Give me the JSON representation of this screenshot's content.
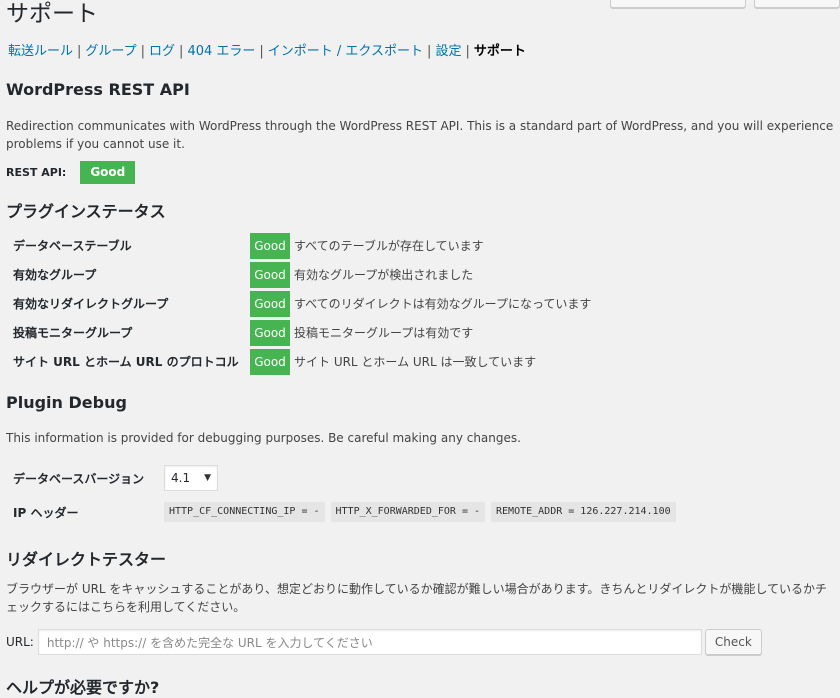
{
  "page": {
    "title": "サポート"
  },
  "nav": {
    "items": [
      "転送ルール",
      "グループ",
      "ログ",
      "404 エラー",
      "インポート / エクスポート",
      "設定"
    ],
    "current": "サポート",
    "separator": "|"
  },
  "rest_api": {
    "heading": "WordPress REST API",
    "description": "Redirection communicates with WordPress through the WordPress REST API. This is a standard part of WordPress, and you will experience problems if you cannot use it.",
    "label": "REST API:",
    "status": "Good"
  },
  "plugin_status": {
    "heading": "プラグインステータス",
    "rows": [
      {
        "label": "データベーステーブル",
        "status": "Good",
        "message": "すべてのテーブルが存在しています"
      },
      {
        "label": "有効なグループ",
        "status": "Good",
        "message": "有効なグループが検出されました"
      },
      {
        "label": "有効なリダイレクトグループ",
        "status": "Good",
        "message": "すべてのリダイレクトは有効なグループになっています"
      },
      {
        "label": "投稿モニターグループ",
        "status": "Good",
        "message": "投稿モニターグループは有効です"
      },
      {
        "label": "サイト URL とホーム URL のプロトコル",
        "status": "Good",
        "message": "サイト URL とホーム URL は一致しています"
      }
    ]
  },
  "debug": {
    "heading": "Plugin Debug",
    "description": "This information is provided for debugging purposes. Be careful making any changes.",
    "db_version_label": "データベースバージョン",
    "db_version_value": "4.1",
    "ip_header_label": "IP ヘッダー",
    "ip_headers": [
      "HTTP_CF_CONNECTING_IP = -",
      "HTTP_X_FORWARDED_FOR = -",
      "REMOTE_ADDR = 126.227.214.100"
    ]
  },
  "tester": {
    "heading": "リダイレクトテスター",
    "description": "ブラウザーが URL をキャッシュすることがあり、想定どおりに動作しているか確認が難しい場合があります。きちんとリダイレクトが機能しているかチェックするにはこちらを利用してください。",
    "url_label": "URL:",
    "url_placeholder": "http:// や https:// を含めた完全な URL を入力してください",
    "check_label": "Check"
  },
  "help": {
    "heading": "ヘルプが必要ですか?"
  },
  "colors": {
    "good": "#46b450",
    "link": "#0073aa",
    "background": "#f1f1f1"
  },
  "icons": {
    "select": "chevron-down-icon"
  }
}
